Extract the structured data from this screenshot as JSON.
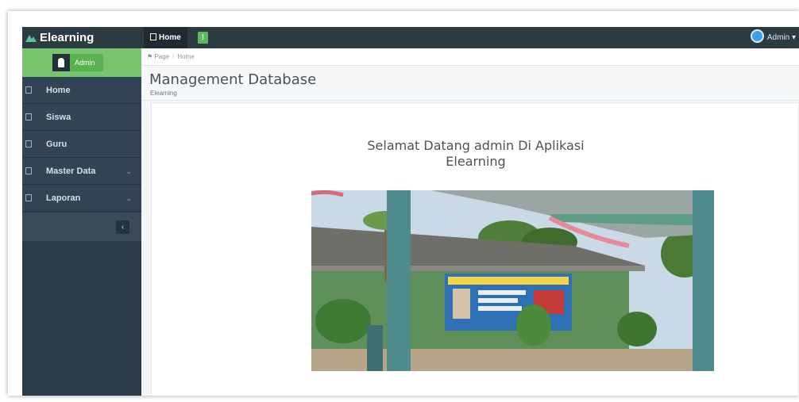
{
  "app": {
    "brand": "Elearning"
  },
  "topbar": {
    "home_label": "Home",
    "badge": "!",
    "user_label": "Admin ▾"
  },
  "sidebar": {
    "user_name": "Admin",
    "items": [
      {
        "label": "Home",
        "icon": "home-icon",
        "chevron": ""
      },
      {
        "label": "Siswa",
        "icon": "edit-icon",
        "chevron": ""
      },
      {
        "label": "Guru",
        "icon": "edit-icon",
        "chevron": ""
      },
      {
        "label": "Master Data",
        "icon": "edit-icon",
        "chevron": "⌄"
      },
      {
        "label": "Laporan",
        "icon": "calendar-icon",
        "chevron": "⌄"
      }
    ],
    "collapse_label": "‹"
  },
  "breadcrumb": {
    "root": "Page",
    "separator": "/",
    "current": "Home"
  },
  "header": {
    "title": "Management Database",
    "subtitle": "Elearning"
  },
  "main": {
    "welcome_line1": "Selamat Datang admin Di Aplikasi",
    "welcome_line2": "Elearning"
  },
  "colors": {
    "navbar": "#2c3b41",
    "sidebar": "#334455",
    "accent_green": "#78c46f"
  }
}
